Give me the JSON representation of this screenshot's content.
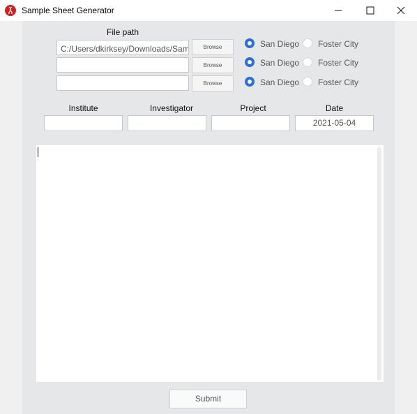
{
  "window": {
    "title": "Sample Sheet Generator"
  },
  "file_section": {
    "header": "File path",
    "rows": [
      {
        "path_value": "C:/Users/dkirksey/Downloads/Sample",
        "browse_label": "Browse",
        "options": [
          "San Diego",
          "Foster City"
        ],
        "selected": "San Diego"
      },
      {
        "path_value": "",
        "browse_label": "Browse",
        "options": [
          "San Diego",
          "Foster City"
        ],
        "selected": "San Diego"
      },
      {
        "path_value": "",
        "browse_label": "Browse",
        "options": [
          "San Diego",
          "Foster City"
        ],
        "selected": "San Diego"
      }
    ]
  },
  "meta": {
    "institute": {
      "label": "Institute",
      "value": ""
    },
    "investigator": {
      "label": "Investigator",
      "value": ""
    },
    "project": {
      "label": "Project",
      "value": ""
    },
    "date": {
      "label": "Date",
      "value": "2021-05-04"
    }
  },
  "notes": {
    "value": ""
  },
  "submit_label": "Submit",
  "colors": {
    "accent": "#2a6fdb",
    "app_icon": "#d21f1f",
    "panel_bg": "#e6e7e8"
  }
}
